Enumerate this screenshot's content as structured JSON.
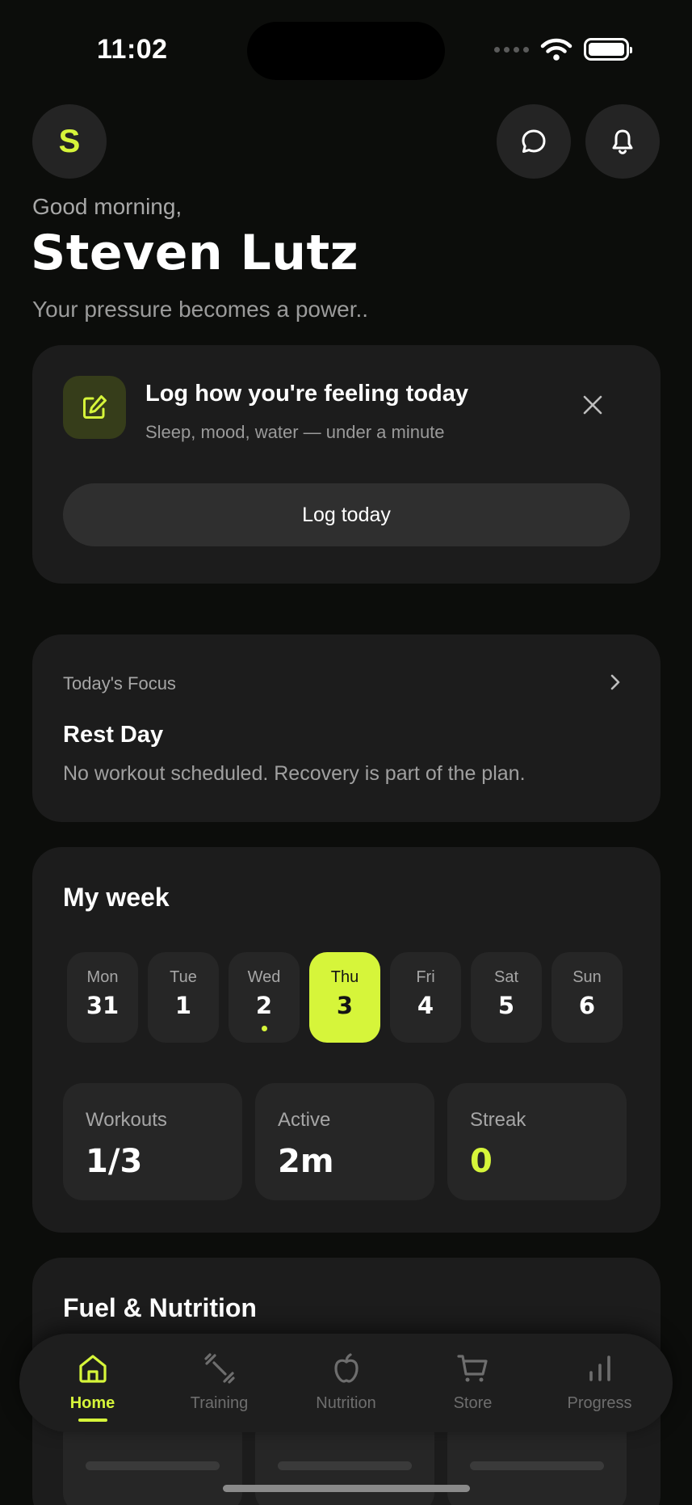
{
  "status_bar": {
    "time": "11:02"
  },
  "header": {
    "avatar_initial": "S",
    "greeting": "Good morning,",
    "user_name": "Steven Lutz",
    "tagline": "Your pressure becomes a power.."
  },
  "log_card": {
    "title": "Log how you're feeling today",
    "subtitle": "Sleep, mood, water — under a minute",
    "button_label": "Log today"
  },
  "focus_card": {
    "label": "Today's Focus",
    "title": "Rest Day",
    "description": "No workout scheduled. Recovery is part of the plan."
  },
  "week": {
    "title": "My week",
    "days": [
      {
        "name": "Mon",
        "num": "31"
      },
      {
        "name": "Tue",
        "num": "1"
      },
      {
        "name": "Wed",
        "num": "2"
      },
      {
        "name": "Thu",
        "num": "3"
      },
      {
        "name": "Fri",
        "num": "4"
      },
      {
        "name": "Sat",
        "num": "5"
      },
      {
        "name": "Sun",
        "num": "6"
      }
    ],
    "stats": [
      {
        "label": "Workouts",
        "value": "1/3"
      },
      {
        "label": "Active",
        "value": "2m"
      },
      {
        "label": "Streak",
        "value": "0"
      }
    ]
  },
  "fuel": {
    "title": "Fuel & Nutrition"
  },
  "tabs": [
    {
      "label": "Home"
    },
    {
      "label": "Training"
    },
    {
      "label": "Nutrition"
    },
    {
      "label": "Store"
    },
    {
      "label": "Progress"
    }
  ],
  "colors": {
    "accent": "#d6f53a",
    "card": "#1c1c1c",
    "background": "#0c0d0b"
  }
}
